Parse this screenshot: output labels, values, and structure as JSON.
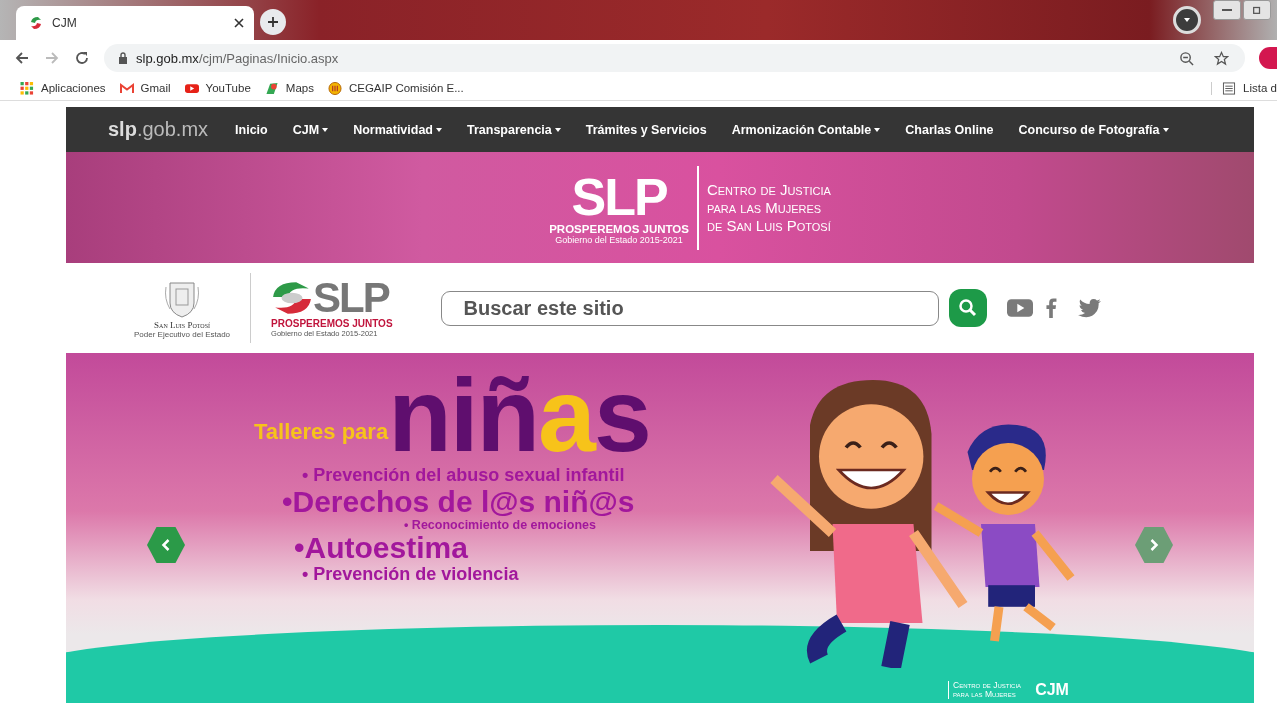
{
  "browser": {
    "tab_title": "CJM",
    "url_host": "slp.gob.mx",
    "url_path": "/cjm/Paginas/Inicio.aspx",
    "bookmarks": [
      {
        "label": "Aplicaciones",
        "kind": "apps"
      },
      {
        "label": "Gmail",
        "kind": "gmail"
      },
      {
        "label": "YouTube",
        "kind": "youtube"
      },
      {
        "label": "Maps",
        "kind": "maps"
      },
      {
        "label": "CEGAIP Comisión E...",
        "kind": "seal"
      }
    ],
    "reading_list": "Lista d"
  },
  "nav": {
    "brand_bold": "slp",
    "brand_rest": ".gob.mx",
    "items": [
      {
        "label": "Inicio",
        "dropdown": false
      },
      {
        "label": "CJM",
        "dropdown": true
      },
      {
        "label": "Normatividad",
        "dropdown": true
      },
      {
        "label": "Transparencia",
        "dropdown": true
      },
      {
        "label": "Trámites y Servicios",
        "dropdown": false
      },
      {
        "label": "Armonización Contable",
        "dropdown": true
      },
      {
        "label": "Charlas Online",
        "dropdown": false
      },
      {
        "label": "Concurso de Fotografía",
        "dropdown": true
      }
    ]
  },
  "header_banner": {
    "logo": "SLP",
    "slogan": "PROSPEREMOS JUNTOS",
    "government": "Gobierno del Estado 2015-2021",
    "center_lines": [
      "Centro de Justicia",
      "para las Mujeres",
      "de San Luis Potosí"
    ]
  },
  "logo_row": {
    "state_name": "San Luis Potosí",
    "state_subtitle": "Poder Ejecutivo del Estado",
    "logo": "SLP",
    "slogan": "PROSPEREMOS JUNTOS",
    "government": "Gobierno del Estado 2015-2021",
    "search": {
      "placeholder": "Buscar este sitio"
    }
  },
  "slider": {
    "prefix": "Talleres para",
    "title": [
      {
        "text": "niñ",
        "highlight": false
      },
      {
        "text": "a",
        "highlight": true
      },
      {
        "text": "s",
        "highlight": false
      }
    ],
    "bullets": [
      {
        "text": "• Prevención del abuso sexual infantil",
        "kind": "medium"
      },
      {
        "text": "•Derechos de l@s niñ@s",
        "kind": "large"
      },
      {
        "text": "• Reconocimiento de emociones",
        "kind": "small"
      },
      {
        "text": "•Autoestima",
        "kind": "large"
      },
      {
        "text": "• Prevención de violencia",
        "kind": "medium"
      }
    ],
    "footer_lines": [
      "Centro de Justicia",
      "para las Mujeres"
    ],
    "footer_logo": "CJM"
  }
}
